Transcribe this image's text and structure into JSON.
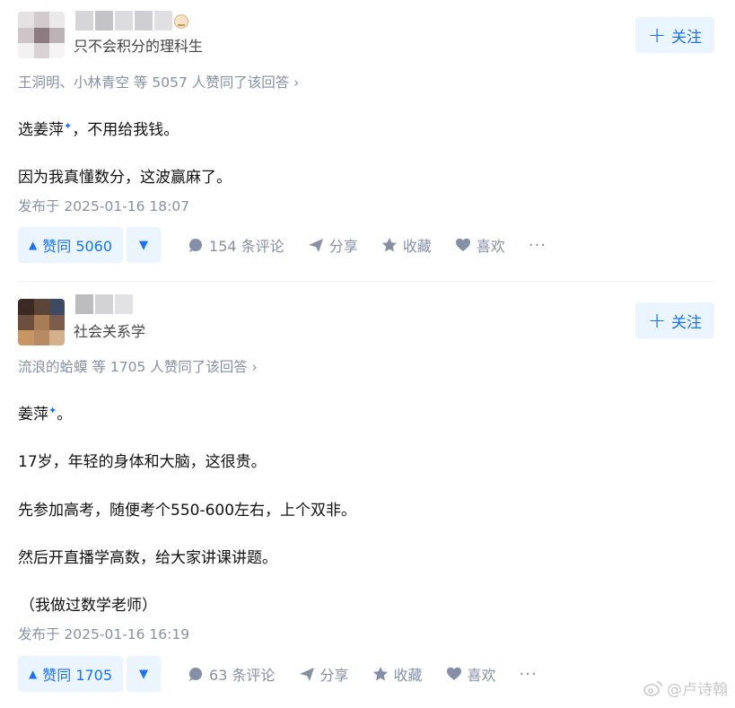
{
  "answers": [
    {
      "subtitle": "只不会积分的理科生",
      "follow_label": "关注",
      "voters": "王洞明、小林青空 等 5057 人赞同了该回答 ›",
      "paragraphs": [
        "选姜萍",
        "，不用给我钱。",
        "因为我真懂数分，这波赢麻了。"
      ],
      "spark": "✦",
      "time": "发布于 2025-01-16 18:07",
      "vote_label": "赞同 5060",
      "comments": "154 条评论",
      "share": "分享",
      "collect": "收藏",
      "like": "喜欢",
      "more": "···"
    },
    {
      "subtitle": "社会关系学",
      "follow_label": "关注",
      "voters": "流浪的蛤蟆 等 1705 人赞同了该回答 ›",
      "paragraphs": [
        "姜萍",
        "。",
        "17岁，年轻的身体和大脑，这很贵。",
        "先参加高考，随便考个550-600左右，上个双非。",
        "然后开直播学高数，给大家讲课讲题。",
        "（我做过数学老师）"
      ],
      "spark": "✦",
      "time": "发布于 2025-01-16 16:19",
      "vote_label": "赞同 1705",
      "comments": "63 条评论",
      "share": "分享",
      "collect": "收藏",
      "like": "喜欢",
      "more": "···"
    }
  ],
  "icons": {
    "vote_up": "▲",
    "vote_down": "▼",
    "plus": "+"
  },
  "watermark": "@卢诗翰",
  "colors": {
    "accent": "#1772f6",
    "accent_bg": "#ebf5ff",
    "meta": "#8590a6"
  }
}
